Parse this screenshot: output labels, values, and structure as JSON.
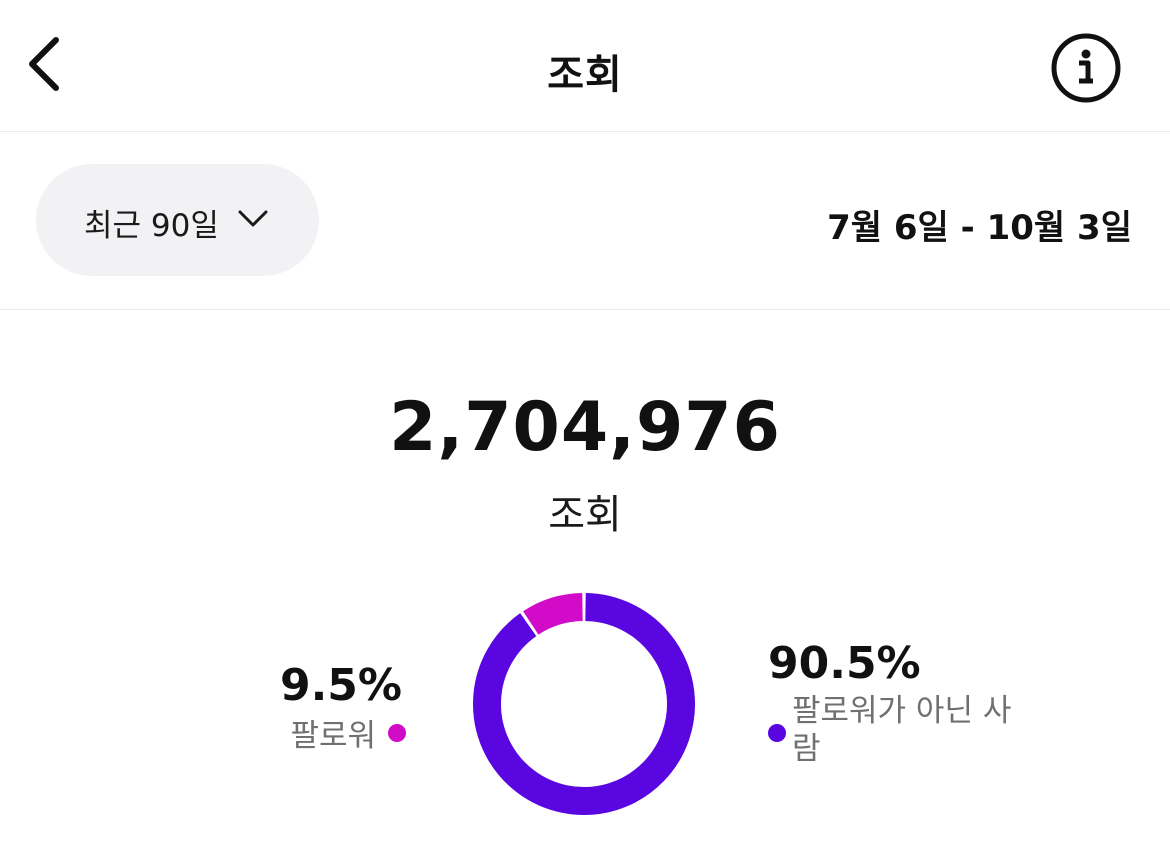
{
  "header": {
    "title": "조회",
    "back_icon": "chevron-left-icon",
    "info_icon": "info-icon"
  },
  "filter": {
    "period_label": "최근 90일",
    "date_range": "7월 6일 - 10월 3일"
  },
  "summary": {
    "total": "2,704,976",
    "label": "조회"
  },
  "breakdown": {
    "followers": {
      "percent_label": "9.5%",
      "label": "팔로워",
      "color": "#d10bc7"
    },
    "non_followers": {
      "percent_label": "90.5%",
      "label": "팔로워가 아닌 사람",
      "color": "#5a06e0"
    }
  },
  "chart_data": {
    "type": "pie",
    "categories": [
      "팔로워",
      "팔로워가 아닌 사람"
    ],
    "values": [
      9.5,
      90.5
    ],
    "colors": [
      "#d10bc7",
      "#5a06e0"
    ],
    "title": "",
    "xlabel": "",
    "ylabel": ""
  }
}
